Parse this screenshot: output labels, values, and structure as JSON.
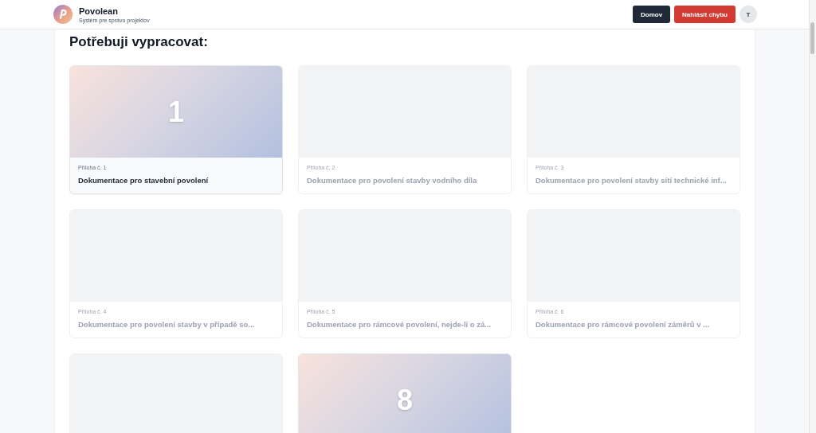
{
  "header": {
    "app_name": "Povolean",
    "subtitle": "Systém pre správu projektov",
    "buttons": [
      {
        "label": "Domov",
        "kind": "dark"
      },
      {
        "label": "Nahlásit chybu",
        "kind": "danger"
      }
    ],
    "avatar": "T"
  },
  "heading": "Potřebuji vypracovat:",
  "cards": [
    {
      "active": true,
      "number": "1",
      "label": "Příloha č. 1",
      "title": "Dokumentace pro stavební povolení"
    },
    {
      "active": false,
      "label": "Příloha č. 2",
      "title": "Dokumentace pro povolení stavby vodního díla"
    },
    {
      "active": false,
      "label": "Příloha č. 3",
      "title": "Dokumentace pro povolení stavby sítí technické inf..."
    },
    {
      "active": false,
      "label": "Příloha č. 4",
      "title": "Dokumentace pro povolení stavby v případě so..."
    },
    {
      "active": false,
      "label": "Příloha č. 5",
      "title": "Dokumentace pro rámcové povolení, nejde-li o zá..."
    },
    {
      "active": false,
      "label": "Příloha č. 6",
      "title": "Dokumentace pro rámcové povolení záměrů v ..."
    },
    {
      "active": false
    },
    {
      "active": true,
      "number": "8"
    }
  ]
}
